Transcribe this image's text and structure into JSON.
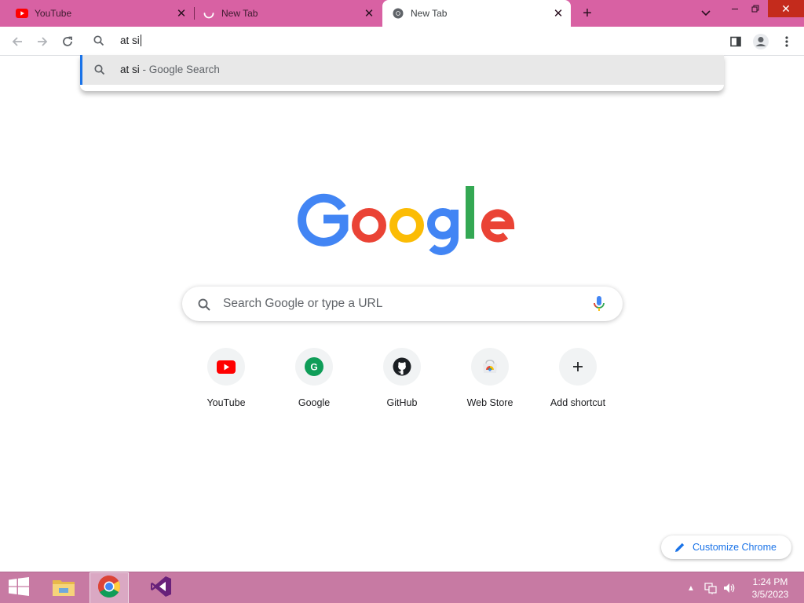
{
  "tabs": [
    {
      "title": "YouTube",
      "favicon": "youtube-icon",
      "active": false
    },
    {
      "title": "New Tab",
      "favicon": "loading-spinner-icon",
      "active": false
    },
    {
      "title": "New Tab",
      "favicon": "chrome-icon",
      "active": true
    }
  ],
  "omnibox": {
    "value": "at si"
  },
  "suggestion": {
    "query": "at si",
    "separator": " - ",
    "source": "Google Search"
  },
  "search": {
    "placeholder": "Search Google or type a URL"
  },
  "shortcuts": [
    {
      "label": "YouTube",
      "icon": "youtube-icon"
    },
    {
      "label": "Google",
      "icon": "google-icon"
    },
    {
      "label": "GitHub",
      "icon": "github-icon"
    },
    {
      "label": "Web Store",
      "icon": "web-store-icon"
    },
    {
      "label": "Add shortcut",
      "icon": "plus-icon"
    }
  ],
  "customize": {
    "label": "Customize Chrome"
  },
  "taskbar": {
    "time": "1:24 PM",
    "date": "3/5/2023"
  },
  "colors": {
    "tabstrip": "#d861a3",
    "taskbar": "#c77aa3",
    "accent": "#1a73e8"
  }
}
